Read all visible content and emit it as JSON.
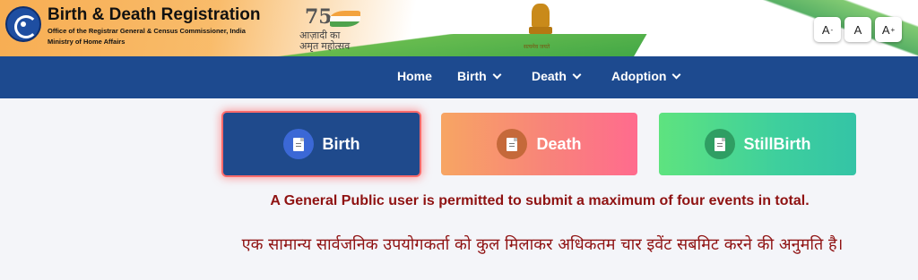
{
  "header": {
    "title": "Birth & Death Registration",
    "subtitle": "Office of the Registrar General & Census Commissioner, India",
    "ministry": "Ministry of Home Affairs",
    "azadi_number": "75",
    "azadi_line1": "आज़ादी का",
    "azadi_line2": "अमृत महोत्सव",
    "emblem_motto": "सत्यमेव जयते",
    "font_decrease": "A",
    "font_decrease_sup": "-",
    "font_normal": "A",
    "font_increase": "A",
    "font_increase_sup": "+"
  },
  "nav": {
    "home": "Home",
    "birth": "Birth",
    "death": "Death",
    "adoption": "Adoption"
  },
  "cards": {
    "birth": "Birth",
    "death": "Death",
    "stillbirth": "StillBirth"
  },
  "notice": {
    "english": "A General Public user is permitted to submit a maximum of four events in total.",
    "hindi": "एक सामान्य सार्वजनिक उपयोगकर्ता को कुल मिलाकर अधिकतम चार इवेंट सबमिट करने की अनुमति है।"
  },
  "colors": {
    "navbar": "#1d4a8f",
    "birth_card": "#1f4a8c",
    "notice_text": "#8f1212"
  }
}
